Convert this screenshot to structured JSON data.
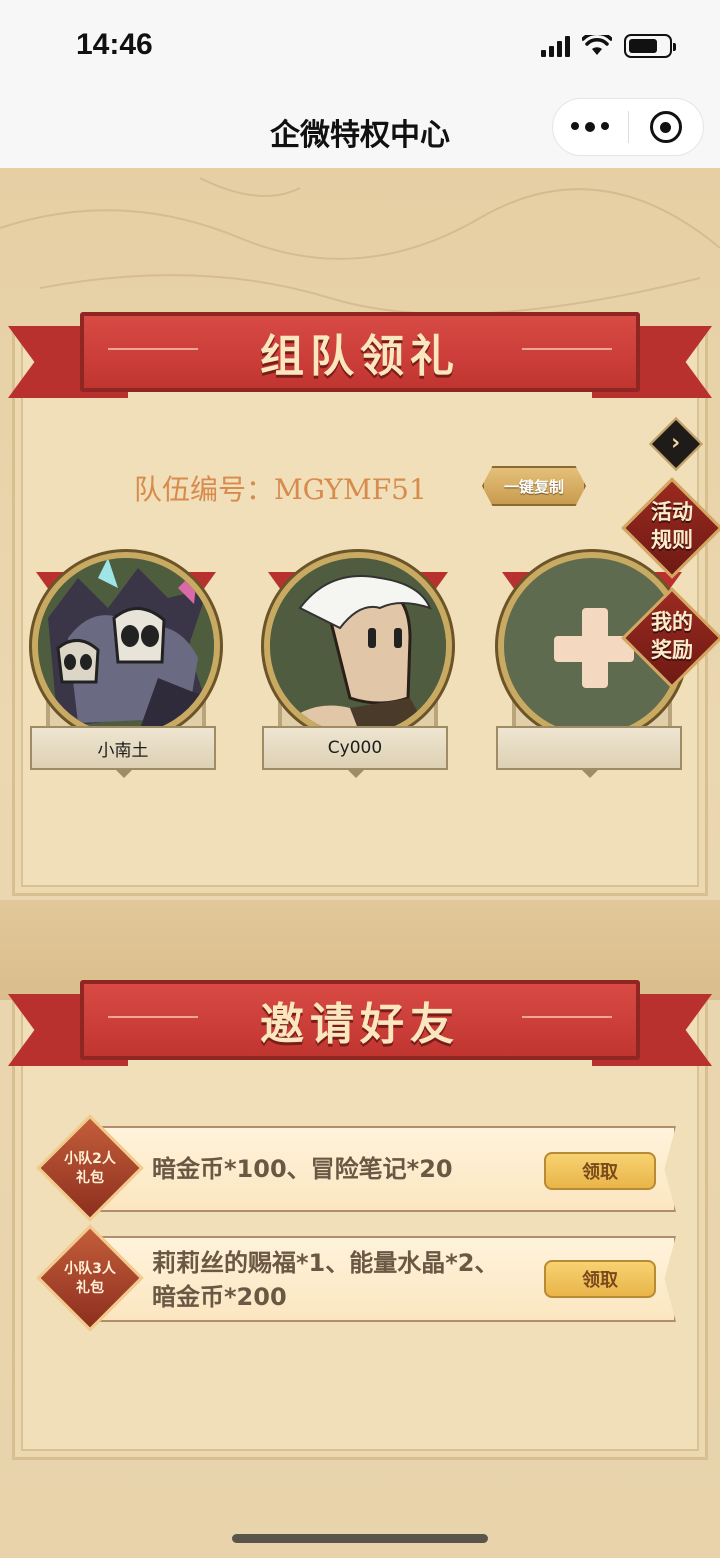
{
  "status_bar": {
    "time": "14:46"
  },
  "nav": {
    "title": "企微特权中心"
  },
  "team_section": {
    "banner": "组队领礼",
    "team_code": "队伍编号：MGYMF51",
    "copy_button": "一键复制",
    "members": [
      {
        "name": "小南土"
      },
      {
        "name": "Cy000"
      },
      {
        "name": ""
      }
    ]
  },
  "side_buttons": {
    "rules": "活动规则",
    "rewards": "我的奖励"
  },
  "invite_section": {
    "banner": "邀请好友",
    "gifts": [
      {
        "badge": "小队2人礼包",
        "rewards_line1": "暗金币*100、冒险笔记*20",
        "rewards_line2": "",
        "claim": "领取"
      },
      {
        "badge": "小队3人礼包",
        "rewards_line1": "莉莉丝的赐福*1、能量水晶*2、",
        "rewards_line2": "暗金币*200",
        "claim": "领取"
      }
    ]
  },
  "colors": {
    "ribbon": "#c13531",
    "panel": "#f0dfb9",
    "accent": "#d78b4c"
  }
}
